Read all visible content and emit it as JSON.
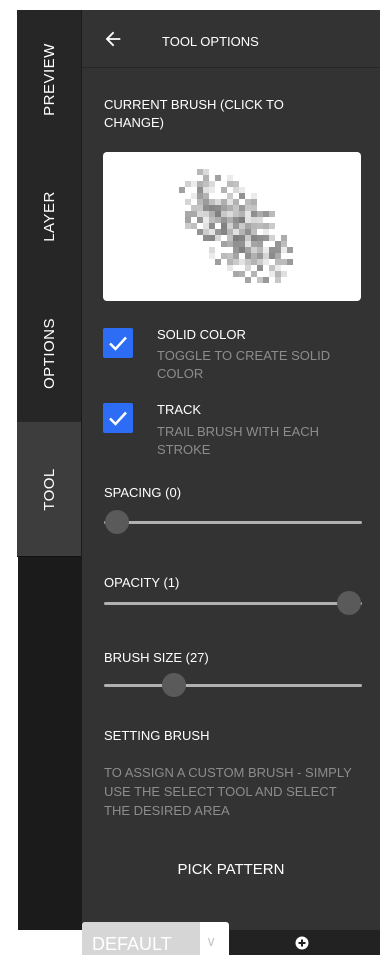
{
  "sidebar": {
    "tabs": [
      {
        "label": "PREVIEW"
      },
      {
        "label": "LAYER"
      },
      {
        "label": "OPTIONS"
      },
      {
        "label": "TOOL"
      }
    ]
  },
  "header": {
    "title": "TOOL OPTIONS",
    "back_icon": "arrow-left-icon"
  },
  "current_brush": {
    "label": "CURRENT BRUSH (CLICK TO CHANGE)"
  },
  "options": [
    {
      "title": "SOLID COLOR",
      "description": "TOGGLE TO CREATE SOLID COLOR",
      "checked": true
    },
    {
      "title": "TRACK",
      "description": "TRAIL BRUSH WITH EACH STROKE",
      "checked": true
    }
  ],
  "sliders": [
    {
      "label": "SPACING (0)",
      "value": 0,
      "fraction": 0.05
    },
    {
      "label": "OPACITY (1)",
      "value": 1,
      "fraction": 0.95
    },
    {
      "label": "BRUSH SIZE (27)",
      "value": 27,
      "fraction": 0.27
    }
  ],
  "setting_brush": {
    "title": "SETTING BRUSH",
    "text": "TO ASSIGN A CUSTOM BRUSH - SIMPLY USE THE SELECT TOOL AND SELECT THE DESIRED AREA"
  },
  "pick_pattern": {
    "label": "PICK PATTERN"
  },
  "bottom": {
    "select_value": "DEFAULT",
    "add_icon": "plus-circle-icon"
  },
  "colors": {
    "accent": "#2d6df6",
    "panel": "#333333",
    "sidebar": "#1b1b1b"
  }
}
